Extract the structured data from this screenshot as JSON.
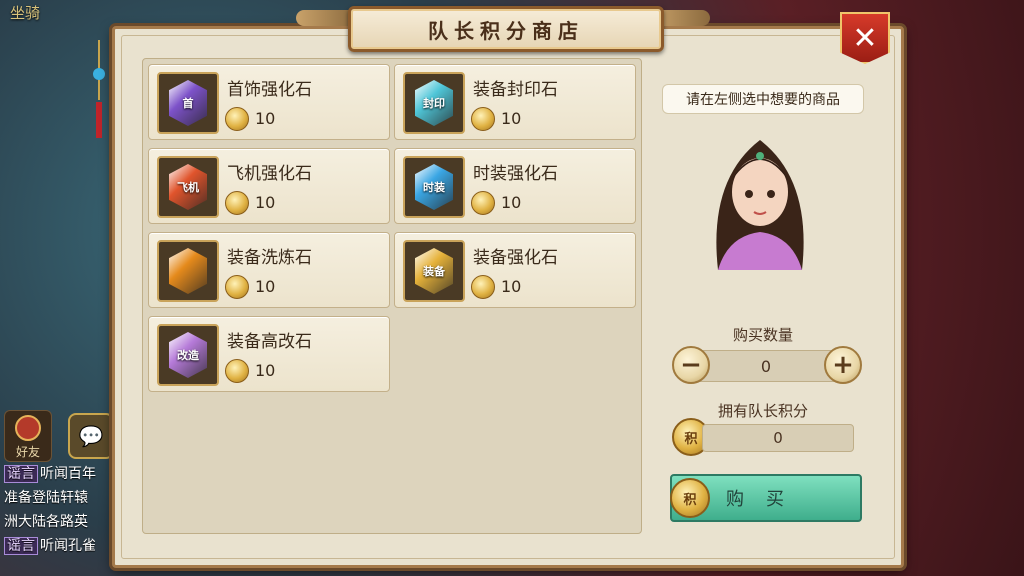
{
  "background": {
    "top_label": "坐骑",
    "friend_label": "好友",
    "chat_lines": [
      {
        "tag": "谣言",
        "text": "听闻百年"
      },
      {
        "tag": "",
        "text": "准备登陆轩辕"
      },
      {
        "tag": "",
        "text": "洲大陆各路英"
      },
      {
        "tag": "谣言",
        "text": "听闻孔雀"
      }
    ]
  },
  "panel": {
    "title": "队长积分商店",
    "close_icon": "close-icon"
  },
  "items": [
    {
      "name": "首饰强化石",
      "price": "10",
      "gem_color": "#7d52c9",
      "glyph": "首"
    },
    {
      "name": "装备封印石",
      "price": "10",
      "gem_color": "#4fc6d8",
      "glyph": "封印"
    },
    {
      "name": "飞机强化石",
      "price": "10",
      "gem_color": "#e0542c",
      "glyph": "飞机"
    },
    {
      "name": "时装强化石",
      "price": "10",
      "gem_color": "#3aa6e4",
      "glyph": "时装"
    },
    {
      "name": "装备洗炼石",
      "price": "10",
      "gem_color": "#e58a1c",
      "glyph": ""
    },
    {
      "name": "装备强化石",
      "price": "10",
      "gem_color": "#e6b23a",
      "glyph": "装备"
    },
    {
      "name": "装备高改石",
      "price": "10",
      "gem_color": "#b57ad8",
      "glyph": "改造"
    }
  ],
  "right": {
    "hint": "请在左侧选中想要的商品",
    "qty_label": "购买数量",
    "qty_value": "0",
    "points_label": "拥有队长积分",
    "points_value": "0",
    "coin_glyph": "积",
    "buy_label": "购买"
  }
}
